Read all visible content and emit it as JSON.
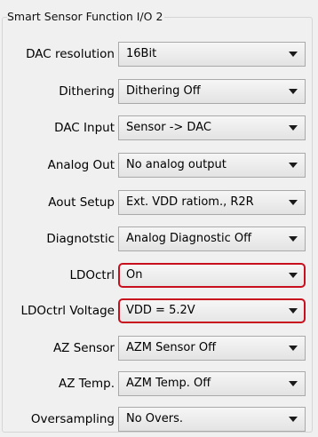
{
  "group": {
    "title": "Smart Sensor Function I/O 2"
  },
  "rows": [
    {
      "label": "DAC resolution",
      "value": "16Bit",
      "highlighted": false
    },
    {
      "label": "Dithering",
      "value": "Dithering Off",
      "highlighted": false
    },
    {
      "label": "DAC Input",
      "value": "Sensor -> DAC",
      "highlighted": false
    },
    {
      "label": "Analog Out",
      "value": "No analog output",
      "highlighted": false
    },
    {
      "label": "Aout Setup",
      "value": "Ext. VDD ratiom., R2R",
      "highlighted": false
    },
    {
      "label": "Diagnotstic",
      "value": "Analog Diagnostic Off",
      "highlighted": false
    },
    {
      "label": "LDOctrl",
      "value": "On",
      "highlighted": true
    },
    {
      "label": "LDOctrl Voltage",
      "value": "VDD = 5.2V",
      "highlighted": true
    },
    {
      "label": "AZ Sensor",
      "value": "AZM Sensor Off",
      "highlighted": false
    },
    {
      "label": "AZ Temp.",
      "value": "AZM Temp. Off",
      "highlighted": false
    },
    {
      "label": "Oversampling",
      "value": "No Overs.",
      "highlighted": false
    }
  ],
  "icons": {
    "dropdown": "chevron-down-icon"
  },
  "colors": {
    "highlight_border": "#c80f1e",
    "background": "#f0f0f0"
  }
}
